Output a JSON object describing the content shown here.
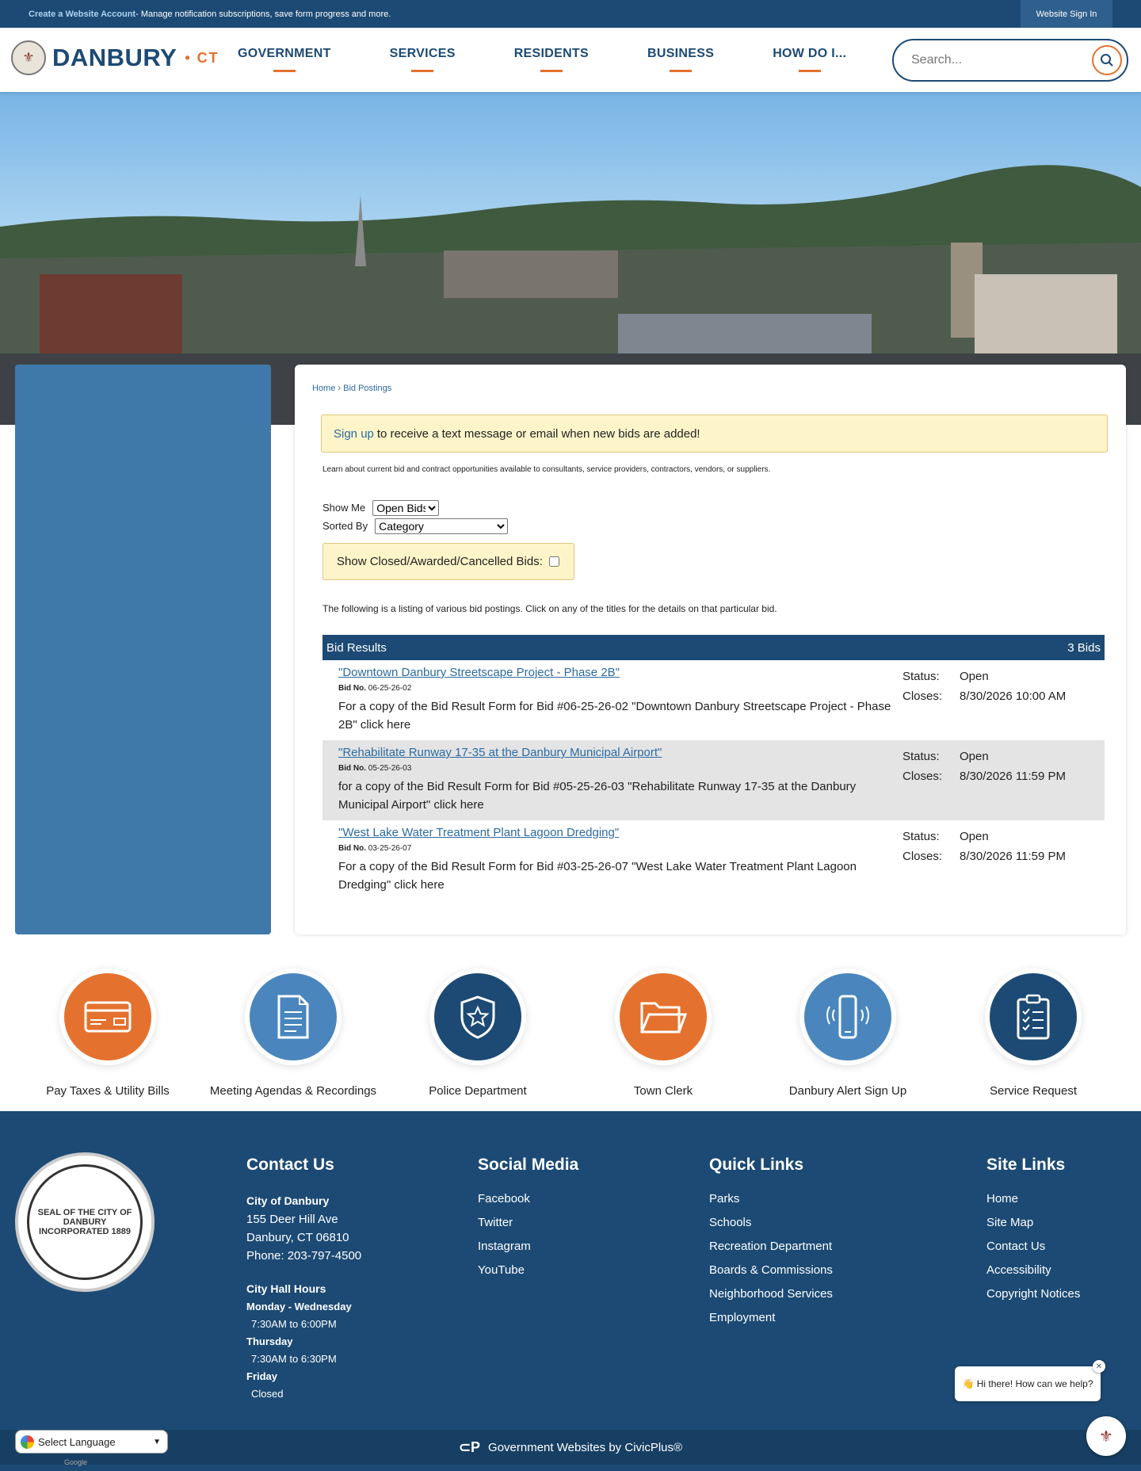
{
  "topbar": {
    "create_account": "Create a Website Account",
    "create_account_desc": " - Manage notification subscriptions, save form progress and more.",
    "sign_in": "Website Sign In"
  },
  "header": {
    "logo_text": "DANBURY",
    "logo_suffix": "• CT",
    "nav": [
      "GOVERNMENT",
      "SERVICES",
      "RESIDENTS",
      "BUSINESS",
      "HOW DO I..."
    ],
    "search_placeholder": "Search..."
  },
  "breadcrumb": {
    "home": "Home",
    "separator": "›",
    "current": "Bid Postings"
  },
  "notice": {
    "link": "Sign up",
    "text": "to receive a text message or email when new bids are added!"
  },
  "intro": "Learn about current bid and contract opportunities available to consultants, service providers, contractors, vendors, or suppliers.",
  "filters": {
    "show_me_label": "Show Me",
    "show_me_value": "Open Bids",
    "sorted_by_label": "Sorted By",
    "sorted_by_value": "Category",
    "closed_label": "Show Closed/Awarded/Cancelled Bids:"
  },
  "listing_text": "The following is a listing of various bid postings. Click on any of the titles for the details on that particular bid.",
  "results": {
    "title": "Bid Results",
    "count": "3 Bids",
    "bid_no_label": "Bid No.",
    "status_label": "Status:",
    "closes_label": "Closes:",
    "bids": [
      {
        "title": "\"Downtown Danbury Streetscape Project - Phase 2B\"",
        "number": "06-25-26-02",
        "desc": "For a copy of the Bid Result Form for Bid #06-25-26-02 \"Downtown Danbury Streetscape Project - Phase 2B\" click here",
        "status": "Open",
        "closes": "8/30/2026 10:00 AM"
      },
      {
        "title": "\"Rehabilitate Runway 17-35 at the Danbury Municipal Airport\"",
        "number": "05-25-26-03",
        "desc": "for a copy of the Bid Result Form for Bid #05-25-26-03 \"Rehabilitate Runway 17-35 at the Danbury Municipal Airport\" click here",
        "status": "Open",
        "closes": "8/30/2026 11:59 PM"
      },
      {
        "title": "\"West Lake Water Treatment Plant Lagoon Dredging\"",
        "number": "03-25-26-07",
        "desc": "For a copy of the Bid Result Form for Bid #03-25-26-07 \"West Lake Water Treatment Plant Lagoon Dredging\" click here",
        "status": "Open",
        "closes": "8/30/2026 11:59 PM"
      }
    ]
  },
  "quick_links": [
    {
      "label": "Pay Taxes & Utility Bills",
      "icon": "credit-card-icon",
      "color": "#e5712e"
    },
    {
      "label": "Meeting Agendas & Recordings",
      "icon": "document-icon",
      "color": "#4a86bd"
    },
    {
      "label": "Police Department",
      "icon": "police-badge-icon",
      "color": "#1c4a74"
    },
    {
      "label": "Town Clerk",
      "icon": "folder-icon",
      "color": "#e5712e"
    },
    {
      "label": "Danbury Alert Sign Up",
      "icon": "phone-alert-icon",
      "color": "#4a86bd"
    },
    {
      "label": "Service Request",
      "icon": "clipboard-icon",
      "color": "#1c4a74"
    }
  ],
  "footer": {
    "seal_text": "SEAL OF THE CITY OF DANBURY INCORPORATED 1889",
    "contact": {
      "heading": "Contact Us",
      "name": "City of Danbury",
      "street": "155 Deer Hill Ave",
      "city": "Danbury, CT 06810",
      "phone": "Phone: 203-797-4500",
      "hours_heading": "City Hall Hours",
      "hours": [
        {
          "days": "Monday - Wednesday",
          "time": "7:30AM to 6:00PM"
        },
        {
          "days": "Thursday",
          "time": "7:30AM to 6:30PM"
        },
        {
          "days": "Friday",
          "time": "Closed"
        }
      ]
    },
    "social": {
      "heading": "Social Media",
      "links": [
        "Facebook",
        "Twitter",
        "Instagram",
        "YouTube"
      ]
    },
    "quick": {
      "heading": "Quick Links",
      "links": [
        "Parks",
        "Schools",
        "Recreation Department",
        "Boards & Commissions",
        "Neighborhood Services",
        "Employment"
      ]
    },
    "site": {
      "heading": "Site Links",
      "links": [
        "Home",
        "Site Map",
        "Contact Us",
        "Accessibility",
        "Copyright Notices"
      ]
    }
  },
  "chat": {
    "greeting": "👋 Hi there! How can we help?"
  },
  "bottom": {
    "credit": "Government Websites by CivicPlus®"
  },
  "language": {
    "label": "Select Language",
    "powered": "Google"
  },
  "colors": {
    "navy": "#1c4a74",
    "orange": "#e5712e",
    "sidebar": "#3f79a9",
    "notice_bg": "#fdf5c9"
  }
}
